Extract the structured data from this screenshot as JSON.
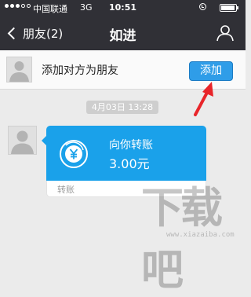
{
  "status_bar": {
    "carrier": "中国联通",
    "network": "3G",
    "time": "10:51"
  },
  "nav": {
    "back_label": "朋友(2)",
    "title": "如进"
  },
  "banner": {
    "text": "添加对方为朋友",
    "add_label": "添加"
  },
  "chat": {
    "timestamp": "4月03日 13:28",
    "transfer": {
      "label": "向你转账",
      "amount": "3.00元",
      "footer": "转账"
    }
  },
  "watermark": {
    "text": "下载吧",
    "subtext": "www.xiazaiba.com"
  },
  "colors": {
    "header_bg": "#303036",
    "accent": "#1aa1ea",
    "arrow": "#e8252a"
  },
  "icons": {
    "back": "chevron-left-icon",
    "profile": "person-icon",
    "transfer": "yen-exchange-icon"
  }
}
